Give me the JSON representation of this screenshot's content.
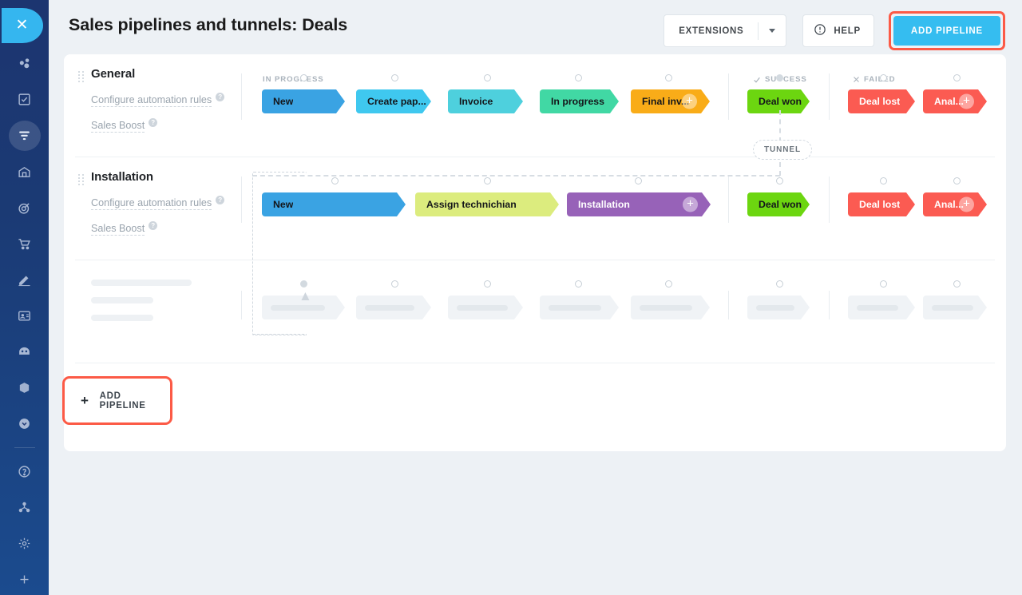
{
  "header": {
    "title": "Sales pipelines and tunnels: Deals",
    "extensions_label": "EXTENSIONS",
    "help_label": "HELP",
    "add_pipeline_label": "ADD PIPELINE",
    "accent_blue": "#35bdf0",
    "highlight_red": "#fc5a46"
  },
  "sidebar": {
    "logo": "close-icon",
    "items": [
      {
        "name": "leads-icon"
      },
      {
        "name": "tasks-icon"
      },
      {
        "name": "pipeline-icon",
        "selected": true
      },
      {
        "name": "warehouse-icon"
      },
      {
        "name": "goals-icon"
      },
      {
        "name": "cart-icon"
      },
      {
        "name": "signature-icon"
      },
      {
        "name": "contacts-icon"
      },
      {
        "name": "bot-icon"
      },
      {
        "name": "box-icon"
      },
      {
        "name": "chevron-circle-icon"
      }
    ],
    "footer_items": [
      {
        "name": "help-circle-icon"
      },
      {
        "name": "network-icon"
      },
      {
        "name": "settings-gear-icon"
      },
      {
        "name": "add-plus-icon"
      }
    ]
  },
  "sections": {
    "in_progress": "IN PROGRESS",
    "success": "SUCCESS",
    "failed": "FAILED"
  },
  "tunnel": {
    "label": "TUNNEL"
  },
  "links": {
    "automation": "Configure automation rules",
    "sales_boost": "Sales Boost"
  },
  "pipelines": [
    {
      "name": "General",
      "in_progress": [
        {
          "label": "New",
          "color": "#3aa3e3",
          "text": "dark",
          "width": 104,
          "plus": false
        },
        {
          "label": "Create pap...",
          "color": "#3fc8ef",
          "text": "dark",
          "width": 94,
          "plus": false
        },
        {
          "label": "Invoice",
          "color": "#4ed0dd",
          "text": "dark",
          "width": 94,
          "plus": false
        },
        {
          "label": "In progress",
          "color": "#41d8a4",
          "text": "dark",
          "width": 99,
          "plus": false
        },
        {
          "label": "Final inv...",
          "color": "#f9ac18",
          "text": "dark",
          "width": 99,
          "plus": true
        }
      ],
      "success": [
        {
          "label": "Deal won",
          "color": "#6cd610",
          "text": "dark",
          "width": 78,
          "plus": false
        }
      ],
      "failed": [
        {
          "label": "Deal lost",
          "color": "#fb5b52",
          "text": "light",
          "width": 84,
          "plus": false
        },
        {
          "label": "Anal...",
          "color": "#fb5b52",
          "text": "light",
          "width": 80,
          "plus": true
        }
      ]
    },
    {
      "name": "Installation",
      "in_progress": [
        {
          "label": "New",
          "color": "#3aa3e3",
          "text": "dark",
          "width": 180,
          "plus": false
        },
        {
          "label": "Assign technichian",
          "color": "#dcec7e",
          "text": "dark",
          "width": 180,
          "plus": false
        },
        {
          "label": "Installation",
          "color": "#9762b8",
          "text": "light",
          "width": 180,
          "plus": true
        }
      ],
      "success": [
        {
          "label": "Deal won",
          "color": "#6cd610",
          "text": "dark",
          "width": 78,
          "plus": false
        }
      ],
      "failed": [
        {
          "label": "Deal lost",
          "color": "#fb5b52",
          "text": "light",
          "width": 84,
          "plus": false
        },
        {
          "label": "Anal...",
          "color": "#fb5b52",
          "text": "light",
          "width": 80,
          "plus": true
        }
      ]
    }
  ],
  "skeleton_row": {
    "in_progress_widths": [
      104,
      94,
      94,
      99,
      99
    ],
    "success_widths": [
      78
    ],
    "failed_widths": [
      84,
      80
    ]
  },
  "footer": {
    "add_pipeline_label": "ADD PIPELINE"
  }
}
